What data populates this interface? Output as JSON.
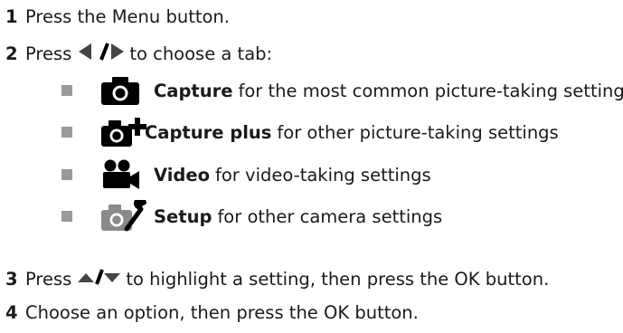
{
  "steps": [
    {
      "number": "1",
      "text": "Press the Menu button."
    },
    {
      "number": "2",
      "before": "Press",
      "after": "to choose a tab:",
      "icon": "left-right-arrows-icon"
    },
    {
      "number": "3",
      "before": "Press",
      "after": "to highlight a setting, then press the OK button.",
      "icon": "up-down-arrows-icon"
    },
    {
      "number": "4",
      "text": "Choose an option, then press the OK button."
    }
  ],
  "tabs": [
    {
      "name": "Capture",
      "description": "for the most common picture-taking settings",
      "icon": "camera-icon"
    },
    {
      "name": "Capture plus",
      "description": "for other picture-taking settings",
      "icon": "camera-plus-icon"
    },
    {
      "name": "Video",
      "description": "for video-taking settings",
      "icon": "video-camera-icon"
    },
    {
      "name": "Setup",
      "description": "for other camera settings",
      "icon": "setup-camera-wrench-icon"
    }
  ],
  "colors": {
    "text": "#1a1a1a",
    "bullet": "#9a9a9a",
    "icon": "#000000",
    "setup_icon_fill": "#8a8a8a"
  }
}
